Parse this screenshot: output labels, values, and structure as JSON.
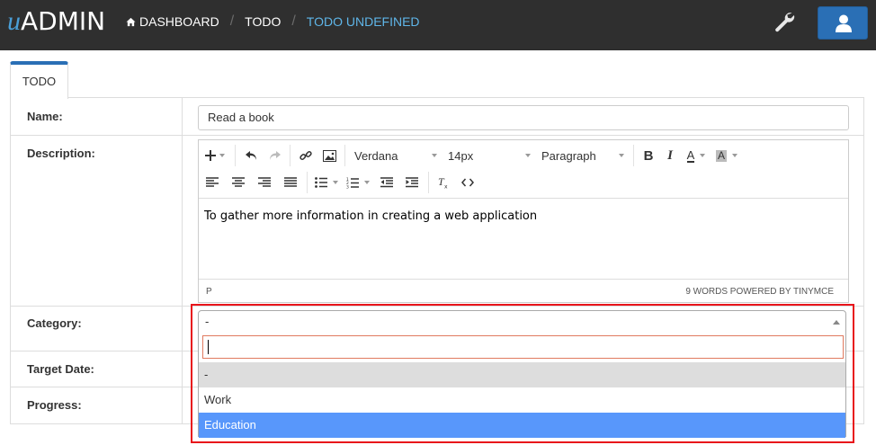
{
  "header": {
    "logo_u": "u",
    "logo_admin": "ADMIN",
    "breadcrumbs": [
      "DASHBOARD",
      "TODO",
      "TODO UNDEFINED"
    ]
  },
  "tab": {
    "label": "TODO"
  },
  "form": {
    "name_label": "Name:",
    "name_value": "Read a book",
    "description_label": "Description:",
    "category_label": "Category:",
    "target_date_label": "Target Date:",
    "progress_label": "Progress:"
  },
  "editor": {
    "font_family": "Verdana",
    "font_size": "14px",
    "block_format": "Paragraph",
    "content": "To gather more information in creating a web application",
    "status_path": "P",
    "word_count": "9 WORDS POWERED BY TINYMCE"
  },
  "category": {
    "selected": "-",
    "search_value": "",
    "options": [
      "-",
      "Work",
      "Education"
    ],
    "highlighted_option": "-",
    "hovered_option": "Education"
  },
  "colors": {
    "topbar": "#2f2f2f",
    "accent": "#2a6fb5",
    "active_crumb": "#5fb6e9",
    "option_hover": "#5897fb",
    "annotation_box": "#e8141b"
  },
  "icons": [
    "home-icon",
    "wrench-icon",
    "user-icon",
    "plus-icon",
    "undo-icon",
    "redo-icon",
    "link-icon",
    "image-icon",
    "bold-icon",
    "italic-icon",
    "text-color-icon",
    "background-color-icon",
    "align-left-icon",
    "align-center-icon",
    "align-right-icon",
    "align-justify-icon",
    "bullet-list-icon",
    "numbered-list-icon",
    "outdent-icon",
    "indent-icon",
    "clear-format-icon",
    "source-code-icon"
  ]
}
